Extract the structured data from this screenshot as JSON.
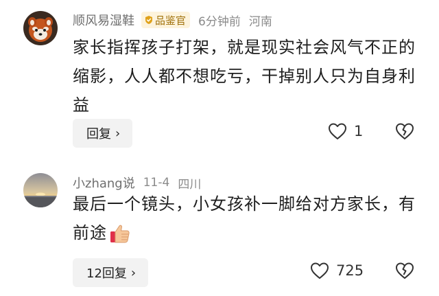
{
  "comments": [
    {
      "username": "顺风易湿鞋",
      "badge": "品鉴官",
      "time": "6分钟前",
      "location": "河南",
      "text": "家长指挥孩子打架，就是现实社会风气不正的缩影，人人都不想吃亏，干掉别人只为自身利益",
      "reply_label": "回复",
      "like_count": "1",
      "avatar_icon": "red-panda-avatar",
      "colors": {
        "badge_bg": "#fdf3dc",
        "badge_text": "#a0710b"
      }
    },
    {
      "username": "小zhang说",
      "time": "11-4",
      "location": "四川",
      "text": "最后一个镜头，小女孩补一脚给对方家长，有前途",
      "emoji": "thumbs-up-emoji",
      "reply_label": "12回复",
      "like_count": "725",
      "avatar_icon": "sunset-avatar"
    }
  ]
}
